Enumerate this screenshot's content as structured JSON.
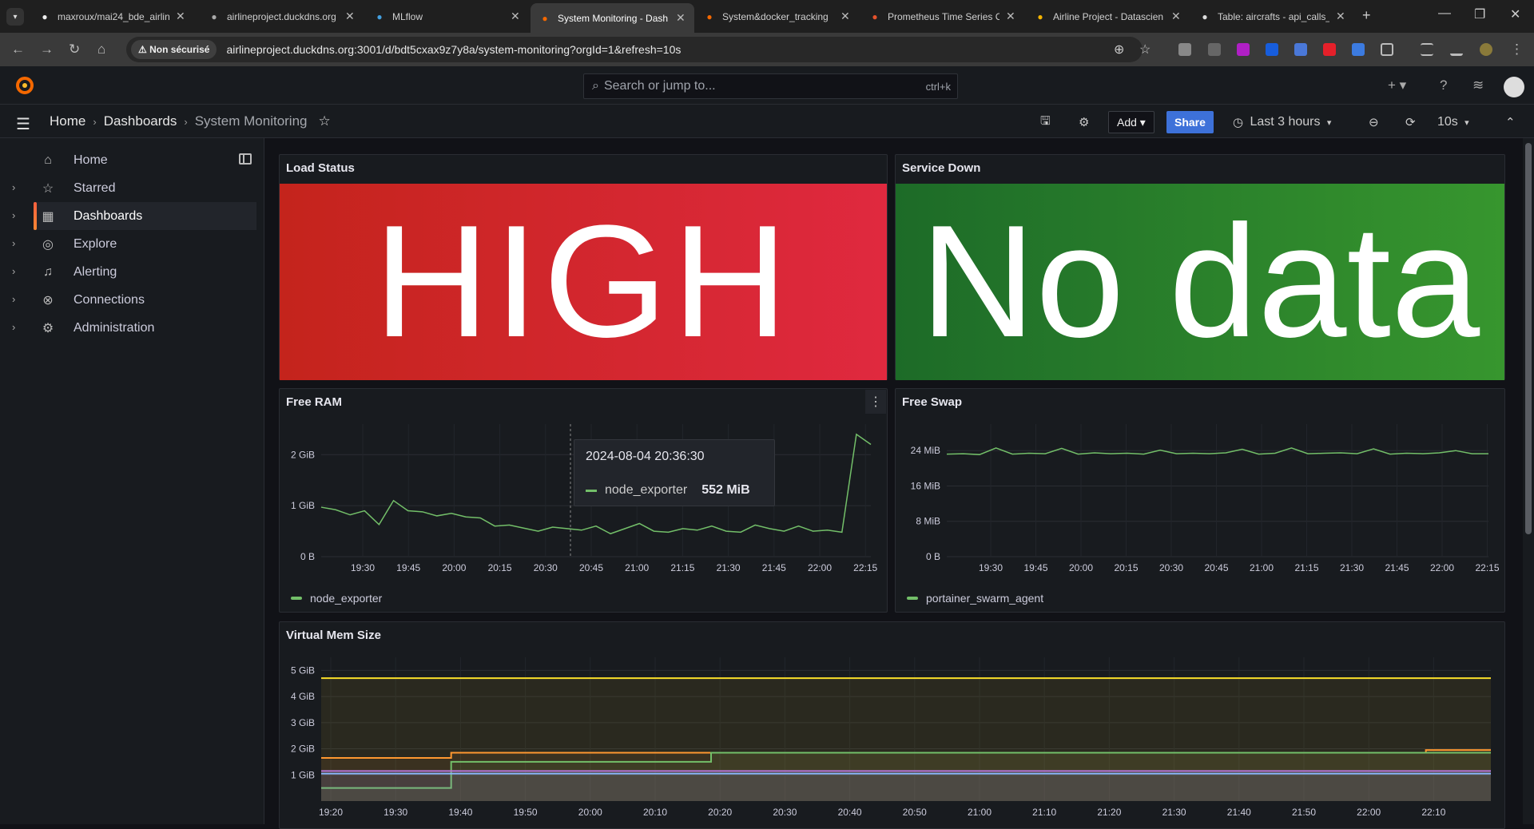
{
  "browser": {
    "tabs": [
      {
        "label": "maxroux/mai24_bde_airlin",
        "icon": "github-icon"
      },
      {
        "label": "airlineproject.duckdns.org",
        "icon": "globe-icon"
      },
      {
        "label": "MLflow",
        "icon": "mlflow-icon"
      },
      {
        "label": "System Monitoring - Dash",
        "icon": "grafana-icon",
        "active": true
      },
      {
        "label": "System&docker_tracking",
        "icon": "grafana-icon"
      },
      {
        "label": "Prometheus Time Series C",
        "icon": "prometheus-icon"
      },
      {
        "label": "Airline Project - Datascien",
        "icon": "slides-icon"
      },
      {
        "label": "Table: aircrafts - api_calls_",
        "icon": "table-icon"
      }
    ],
    "security_label": "⚠ Non sécurisé",
    "url": "airlineproject.duckdns.org:3001/d/bdt5cxax9z7y8a/system-monitoring?orgId=1&refresh=10s"
  },
  "grafana": {
    "search_placeholder": "Search or jump to...",
    "search_shortcut": "ctrl+k",
    "breadcrumb": [
      "Home",
      "Dashboards",
      "System Monitoring"
    ],
    "add_label": "Add",
    "share_label": "Share",
    "time_range": "Last 3 hours",
    "refresh_interval": "10s"
  },
  "sidebar": {
    "items": [
      {
        "label": "Home",
        "icon": "home-icon"
      },
      {
        "label": "Starred",
        "icon": "star-icon"
      },
      {
        "label": "Dashboards",
        "icon": "dashboards-icon",
        "active": true
      },
      {
        "label": "Explore",
        "icon": "compass-icon"
      },
      {
        "label": "Alerting",
        "icon": "bell-icon"
      },
      {
        "label": "Connections",
        "icon": "connections-icon"
      },
      {
        "label": "Administration",
        "icon": "gear-icon"
      }
    ]
  },
  "panels": {
    "load_status": {
      "title": "Load Status",
      "value": "HIGH",
      "colors": [
        "#c4241c",
        "#e0293f"
      ]
    },
    "service_down": {
      "title": "Service Down",
      "value": "No data",
      "colors": [
        "#1d6b28",
        "#37962e"
      ]
    },
    "free_ram": {
      "title": "Free RAM",
      "legend": "node_exporter",
      "tooltip": {
        "time": "2024-08-04 20:36:30",
        "series": "node_exporter",
        "value": "552 MiB"
      }
    },
    "free_swap": {
      "title": "Free Swap",
      "legend": "portainer_swarm_agent"
    },
    "virtual_mem": {
      "title": "Virtual Mem Size"
    }
  },
  "chart_data": [
    {
      "type": "line",
      "title": "Free RAM",
      "x_ticks": [
        "19:30",
        "19:45",
        "20:00",
        "20:15",
        "20:30",
        "20:45",
        "21:00",
        "21:15",
        "21:30",
        "21:45",
        "22:00",
        "22:15"
      ],
      "y_ticks": [
        "0 B",
        "1 GiB",
        "2 GiB"
      ],
      "ylim": [
        0,
        2.6
      ],
      "series": [
        {
          "name": "node_exporter",
          "color": "#73bf69",
          "values": [
            0.97,
            0.92,
            0.82,
            0.9,
            0.63,
            1.1,
            0.9,
            0.88,
            0.8,
            0.85,
            0.78,
            0.76,
            0.6,
            0.62,
            0.56,
            0.5,
            0.58,
            0.55,
            0.52,
            0.6,
            0.45,
            0.55,
            0.65,
            0.5,
            0.48,
            0.55,
            0.52,
            0.6,
            0.5,
            0.48,
            0.62,
            0.55,
            0.5,
            0.6,
            0.5,
            0.52,
            0.48,
            2.4,
            2.2
          ]
        }
      ]
    },
    {
      "type": "line",
      "title": "Free Swap",
      "x_ticks": [
        "19:30",
        "19:45",
        "20:00",
        "20:15",
        "20:30",
        "20:45",
        "21:00",
        "21:15",
        "21:30",
        "21:45",
        "22:00",
        "22:15"
      ],
      "y_ticks": [
        "0 B",
        "8 MiB",
        "16 MiB",
        "24 MiB"
      ],
      "ylim": [
        0,
        30
      ],
      "series": [
        {
          "name": "portainer_swarm_agent",
          "color": "#73bf69",
          "values": [
            23.2,
            23.3,
            23.1,
            24.6,
            23.2,
            23.4,
            23.3,
            24.5,
            23.2,
            23.5,
            23.3,
            23.4,
            23.2,
            24.1,
            23.3,
            23.4,
            23.3,
            23.5,
            24.3,
            23.2,
            23.4,
            24.6,
            23.3,
            23.4,
            23.5,
            23.3,
            24.4,
            23.2,
            23.4,
            23.3,
            23.5,
            24.0,
            23.3,
            23.3
          ]
        }
      ]
    },
    {
      "type": "line",
      "title": "Virtual Mem Size",
      "x_ticks": [
        "19:20",
        "19:30",
        "19:40",
        "19:50",
        "20:00",
        "20:10",
        "20:20",
        "20:30",
        "20:40",
        "20:50",
        "21:00",
        "21:10",
        "21:20",
        "21:30",
        "21:40",
        "21:50",
        "22:00",
        "22:10"
      ],
      "y_ticks": [
        "1 GiB",
        "2 GiB",
        "3 GiB",
        "4 GiB",
        "5 GiB"
      ],
      "ylim": [
        0,
        5.5
      ],
      "series": [
        {
          "color": "#fade2a",
          "values": [
            4.7,
            4.7
          ]
        },
        {
          "color": "#ff9830",
          "values": [
            1.65,
            1.65,
            1.85,
            1.85,
            1.85,
            1.85,
            1.85,
            1.85,
            1.85,
            1.85,
            1.85,
            1.85,
            1.85,
            1.85,
            1.85,
            1.85,
            1.85,
            1.95,
            1.95
          ]
        },
        {
          "color": "#73bf69",
          "values": [
            0.5,
            0.5,
            1.5,
            1.5,
            1.5,
            1.5,
            1.85,
            1.85,
            1.85,
            1.85,
            1.85,
            1.85,
            1.85,
            1.85,
            1.85,
            1.85,
            1.85,
            1.85,
            1.85
          ]
        },
        {
          "color": "#b877d9",
          "values": [
            1.15,
            1.15
          ]
        },
        {
          "color": "#8ab8ff",
          "values": [
            1.05,
            1.05
          ]
        }
      ]
    }
  ]
}
